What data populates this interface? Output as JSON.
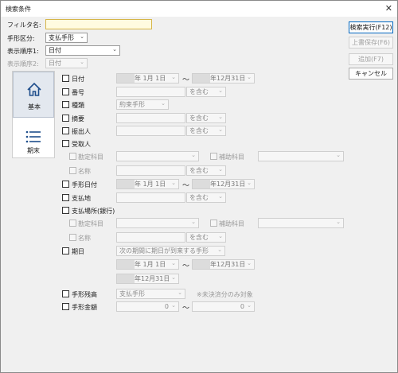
{
  "window": {
    "title": "検索条件",
    "close_glyph": "✕"
  },
  "top": {
    "filter_label": "フィルタ名:",
    "filter_value": "",
    "kubun_label": "手形区分:",
    "kubun_value": "支払手形",
    "order1_label": "表示順序1:",
    "order1_value": "日付",
    "order2_label": "表示順序2:",
    "order2_value": "日付"
  },
  "buttons": {
    "search": "検索実行(F12)",
    "overwrite": "上書保存(F6)",
    "add": "追加(F7)",
    "cancel": "キャンセル"
  },
  "side": {
    "tab_basic": "基本",
    "tab_period": "期末",
    "icons": {
      "basic": "home-icon",
      "period": "list-icon"
    }
  },
  "common": {
    "tilde": "〜",
    "contains": "を含む",
    "date_from": "年 1月 1日",
    "date_to": "年12月31日"
  },
  "fields": {
    "date": "日付",
    "number": "番号",
    "type": "種類",
    "type_value": "約束手形",
    "summary": "摘要",
    "issuer": "振出人",
    "payee": "受取人",
    "account": "勘定科目",
    "subaccount": "補助科目",
    "name": "名称",
    "bill_date": "手形日付",
    "pay_place": "支払地",
    "pay_location": "支払場所(銀行)",
    "account2": "勘定科目",
    "subaccount2": "補助科目",
    "name2": "名称",
    "due": "期日",
    "due_value": "次の期間に期日が到来する手形",
    "balance": "手形残高",
    "balance_value": "支払手形",
    "balance_note": "※未決済分のみ対象",
    "amount": "手形金額",
    "amount_from": "0",
    "amount_to": "0"
  },
  "chevron_glyph": "⌄",
  "colors": {
    "accent": "#0067c0",
    "focus_bg": "#fffbe0",
    "window_bg": "#f0f0f0"
  }
}
